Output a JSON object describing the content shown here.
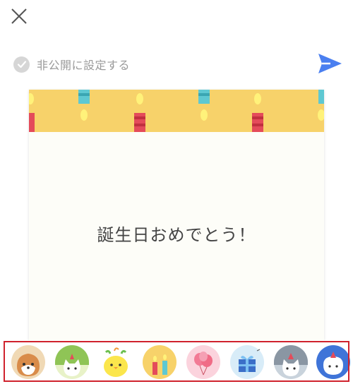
{
  "header": {
    "close_icon": "close-icon",
    "send_icon": "send-paper-plane-icon",
    "private_option": {
      "label": "非公開に設定する",
      "checked": false,
      "icon": "check-circle-icon"
    }
  },
  "card": {
    "theme": "birthday-candles",
    "message": "誕生日おめでとう！",
    "colors": {
      "banner": "#f7d26a",
      "background": "#fdfdf8"
    }
  },
  "stamps": {
    "highlight_color": "#d0222d",
    "items": [
      {
        "icon": "shiba-dog-icon"
      },
      {
        "icon": "green-cat-icon"
      },
      {
        "icon": "yellow-chick-icon"
      },
      {
        "icon": "candles-icon"
      },
      {
        "icon": "balloons-icon"
      },
      {
        "icon": "gift-box-icon"
      },
      {
        "icon": "gray-cat-party-hat-icon"
      },
      {
        "icon": "white-bear-icon"
      }
    ]
  },
  "accent": "#4a7ff0"
}
